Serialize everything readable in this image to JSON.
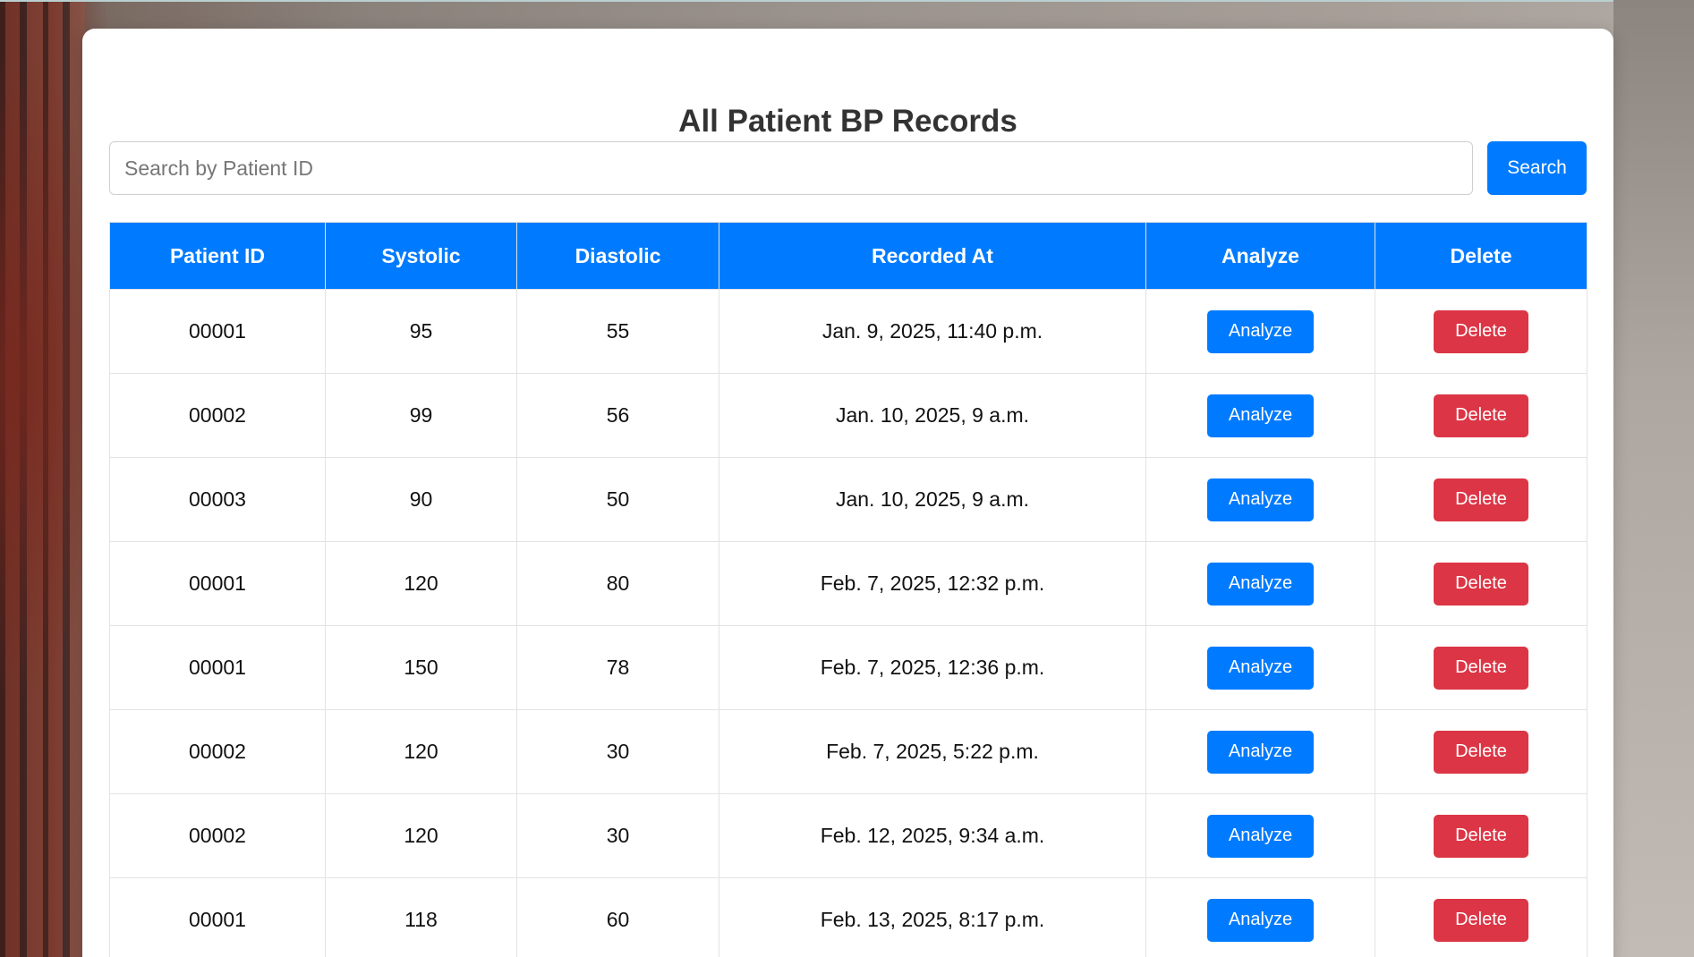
{
  "page": {
    "title": "All Patient BP Records"
  },
  "search": {
    "placeholder": "Search by Patient ID",
    "value": "",
    "button_label": "Search"
  },
  "table": {
    "headers": [
      "Patient ID",
      "Systolic",
      "Diastolic",
      "Recorded At",
      "Analyze",
      "Delete"
    ],
    "analyze_label": "Analyze",
    "delete_label": "Delete",
    "rows": [
      {
        "patient_id": "00001",
        "systolic": "95",
        "diastolic": "55",
        "recorded_at": "Jan. 9, 2025, 11:40 p.m."
      },
      {
        "patient_id": "00002",
        "systolic": "99",
        "diastolic": "56",
        "recorded_at": "Jan. 10, 2025, 9 a.m."
      },
      {
        "patient_id": "00003",
        "systolic": "90",
        "diastolic": "50",
        "recorded_at": "Jan. 10, 2025, 9 a.m."
      },
      {
        "patient_id": "00001",
        "systolic": "120",
        "diastolic": "80",
        "recorded_at": "Feb. 7, 2025, 12:32 p.m."
      },
      {
        "patient_id": "00001",
        "systolic": "150",
        "diastolic": "78",
        "recorded_at": "Feb. 7, 2025, 12:36 p.m."
      },
      {
        "patient_id": "00002",
        "systolic": "120",
        "diastolic": "30",
        "recorded_at": "Feb. 7, 2025, 5:22 p.m."
      },
      {
        "patient_id": "00002",
        "systolic": "120",
        "diastolic": "30",
        "recorded_at": "Feb. 12, 2025, 9:34 a.m."
      },
      {
        "patient_id": "00001",
        "systolic": "118",
        "diastolic": "60",
        "recorded_at": "Feb. 13, 2025, 8:17 p.m."
      }
    ]
  },
  "colors": {
    "primary": "#007bff",
    "danger": "#dc3545",
    "title": "#333333"
  }
}
